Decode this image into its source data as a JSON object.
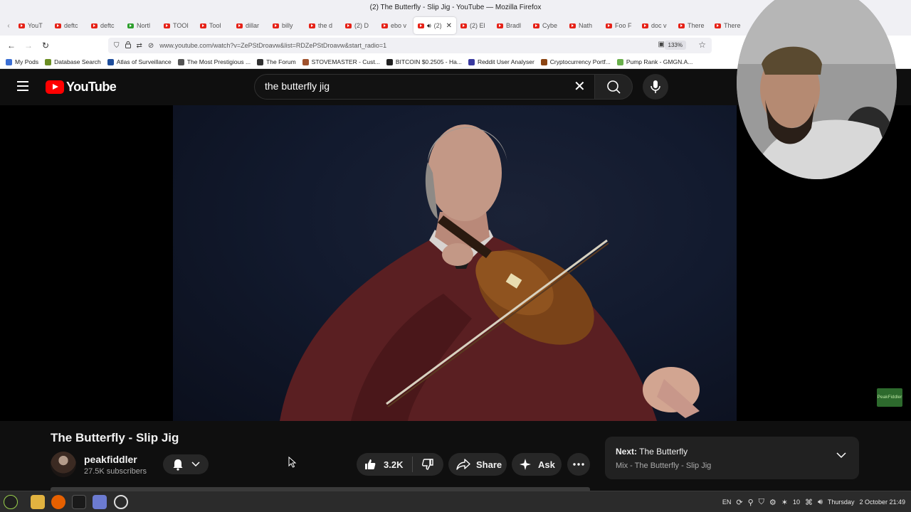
{
  "window": {
    "title": "(2) The Butterfly - Slip Jig - YouTube — Mozilla Firefox"
  },
  "tabs": [
    {
      "label": "YouT",
      "favicon": "youtube-icon"
    },
    {
      "label": "deftc",
      "favicon": "youtube-icon"
    },
    {
      "label": "deftc",
      "favicon": "youtube-icon"
    },
    {
      "label": "Nortl",
      "favicon": "green-n-icon"
    },
    {
      "label": "TOOI",
      "favicon": "youtube-icon"
    },
    {
      "label": "Tool",
      "favicon": "youtube-icon"
    },
    {
      "label": "dillar",
      "favicon": "youtube-icon"
    },
    {
      "label": "billy",
      "favicon": "youtube-icon"
    },
    {
      "label": "the d",
      "favicon": "youtube-icon"
    },
    {
      "label": "(2) D",
      "favicon": "youtube-icon"
    },
    {
      "label": "ebo v",
      "favicon": "youtube-icon"
    },
    {
      "label": "(2)",
      "favicon": "youtube-icon",
      "active": true
    },
    {
      "label": "(2) El",
      "favicon": "youtube-icon"
    },
    {
      "label": "Bradl",
      "favicon": "youtube-icon"
    },
    {
      "label": "Cybe",
      "favicon": "youtube-icon"
    },
    {
      "label": "Nath",
      "favicon": "youtube-icon"
    },
    {
      "label": "Foo F",
      "favicon": "youtube-icon"
    },
    {
      "label": "doc v",
      "favicon": "youtube-icon"
    },
    {
      "label": "There",
      "favicon": "youtube-icon"
    },
    {
      "label": "There",
      "favicon": "youtube-icon"
    }
  ],
  "navbar": {
    "url": "www.youtube.com/watch?v=ZePStDroavw&list=RDZePStDroavw&start_radio=1",
    "zoom": "133%"
  },
  "bookmarks": [
    {
      "label": "My Pods",
      "color": "#3b6fd4"
    },
    {
      "label": "Database Search",
      "color": "#6b8e23"
    },
    {
      "label": "Atlas of Surveillance",
      "color": "#1f4e9c"
    },
    {
      "label": "The Most Prestigious ...",
      "color": "#555555"
    },
    {
      "label": "The Forum",
      "color": "#333333"
    },
    {
      "label": "STOVEMASTER - Cust...",
      "color": "#a0522d"
    },
    {
      "label": "BITCOIN $0.2505 - Ha...",
      "color": "#222222"
    },
    {
      "label": "Reddit User Analyser",
      "color": "#3a3aa0"
    },
    {
      "label": "Cryptocurrency Portf...",
      "color": "#8b4513"
    },
    {
      "label": "Pump Rank - GMGN.A...",
      "color": "#6ab04c"
    }
  ],
  "youtube": {
    "logo_text": "YouTube",
    "search": {
      "value": "the butterfly jig"
    },
    "video": {
      "watermark": "PeakFiddler"
    },
    "title": "The Butterfly - Slip Jig",
    "channel": {
      "name": "peakfiddler",
      "subscribers": "27.5K subscribers"
    },
    "actions": {
      "likes": "3.2K",
      "share": "Share",
      "ask": "Ask"
    },
    "next": {
      "prefix": "Next:",
      "title": "The Butterfly",
      "playlist": "Mix - The Butterfly - Slip Jig"
    }
  },
  "taskbar": {
    "language": "EN",
    "volume_level": "10",
    "day": "Thursday",
    "datetime": "2 October 21:49"
  }
}
